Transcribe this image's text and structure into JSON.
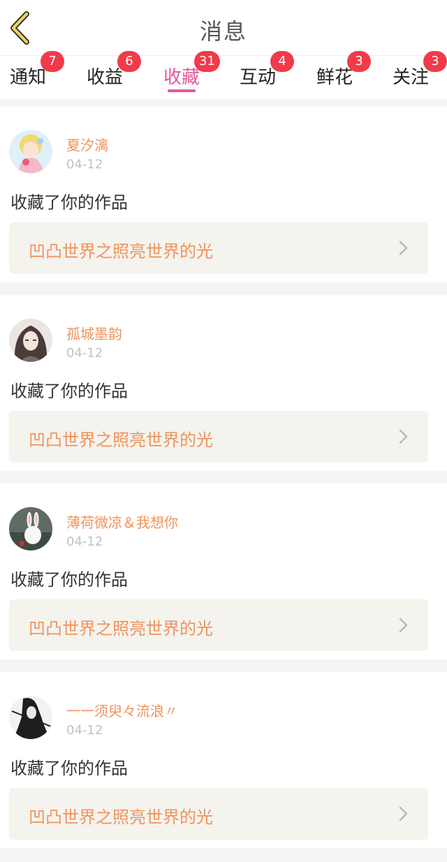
{
  "header": {
    "title": "消息",
    "back_icon": "chevron-left-icon"
  },
  "tabs": [
    {
      "label": "通知",
      "badge": "7",
      "active": false
    },
    {
      "label": "收益",
      "badge": "6",
      "active": false
    },
    {
      "label": "收藏",
      "badge": "31",
      "active": true
    },
    {
      "label": "互动",
      "badge": "4",
      "active": false
    },
    {
      "label": "鲜花",
      "badge": "3",
      "active": false
    },
    {
      "label": "关注",
      "badge": "3",
      "active": false
    }
  ],
  "colors": {
    "accent_pink": "#e5579c",
    "badge_red": "#f23a4a",
    "name_orange": "#f0935a",
    "link_bg": "#f4f3ee"
  },
  "messages": [
    {
      "username": "夏汐漓",
      "date": "04-12",
      "action": "收藏了你的作品",
      "work_title": "凹凸世界之照亮世界的光"
    },
    {
      "username": "孤城墨韵",
      "date": "04-12",
      "action": "收藏了你的作品",
      "work_title": "凹凸世界之照亮世界的光"
    },
    {
      "username": "薄荷微凉＆我想你",
      "date": "04-12",
      "action": "收藏了你的作品",
      "work_title": "凹凸世界之照亮世界的光"
    },
    {
      "username": "一一须臾々流浪〃",
      "date": "04-12",
      "action": "收藏了你的作品",
      "work_title": "凹凸世界之照亮世界的光"
    }
  ]
}
